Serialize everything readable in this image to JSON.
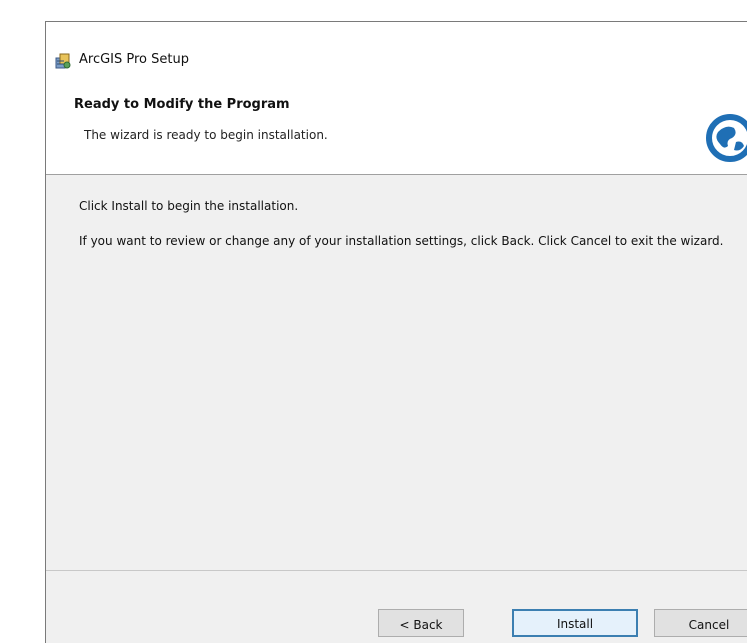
{
  "window": {
    "title": "ArcGIS Pro Setup"
  },
  "header": {
    "title": "Ready to Modify the Program",
    "subtitle": "The wizard is ready to begin installation."
  },
  "body": {
    "line1": "Click Install to begin the installation.",
    "line2": "If you want to review or change any of your installation settings, click Back. Click Cancel to exit the wizard."
  },
  "footer": {
    "back_label": "< Back",
    "install_label": "Install",
    "cancel_label": "Cancel"
  },
  "colors": {
    "globe": "#1f6fb5",
    "install_border": "#3c7fb1",
    "body_bg": "#f0f0f0"
  },
  "icons": {
    "app": "setup-installer-icon",
    "header": "arcgis-globe-icon"
  }
}
